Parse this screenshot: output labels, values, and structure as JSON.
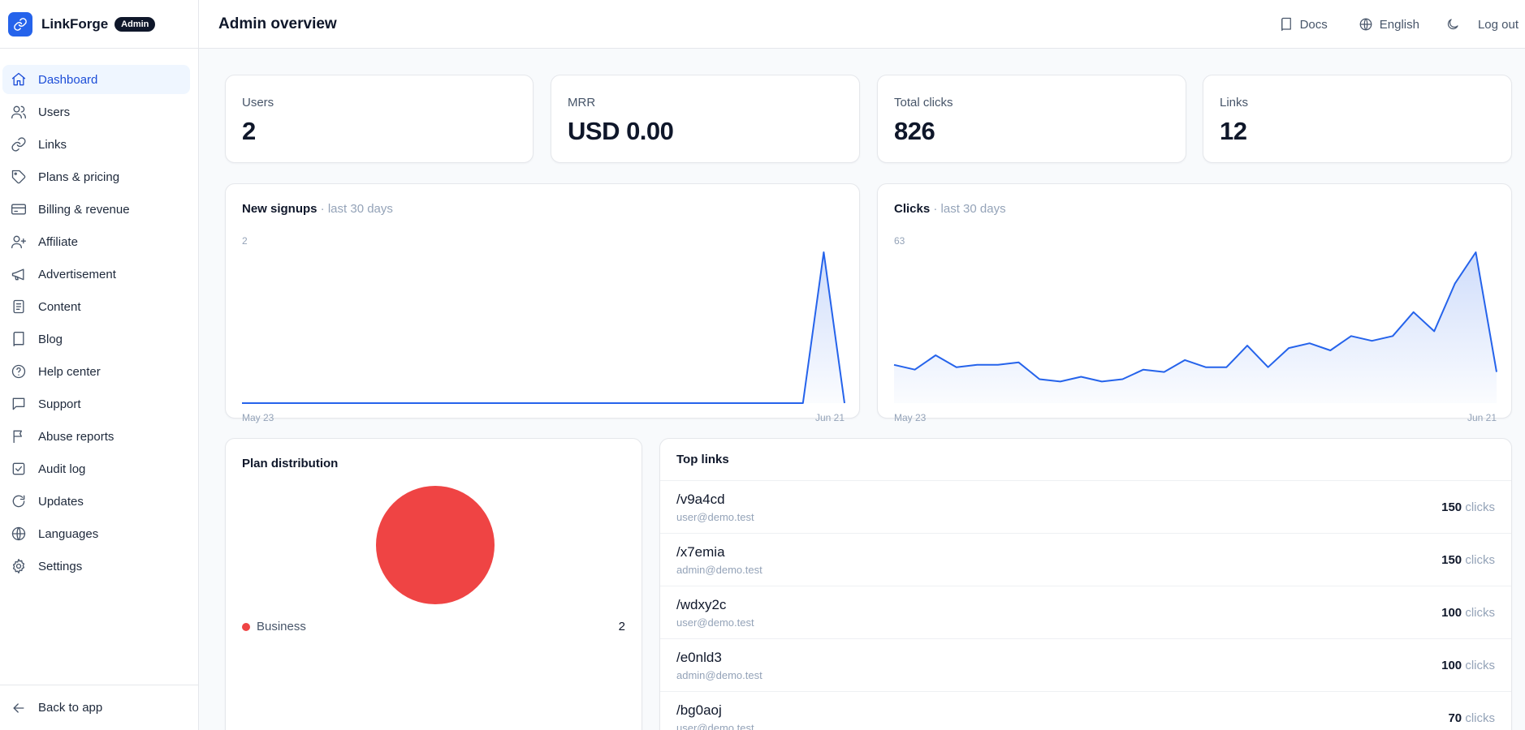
{
  "brand": {
    "name": "LinkForge",
    "badge": "Admin"
  },
  "sidebar": {
    "items": [
      {
        "label": "Dashboard",
        "icon": "home-icon",
        "active": true
      },
      {
        "label": "Users",
        "icon": "users-icon"
      },
      {
        "label": "Links",
        "icon": "link-icon"
      },
      {
        "label": "Plans & pricing",
        "icon": "tag-icon"
      },
      {
        "label": "Billing & revenue",
        "icon": "credit-card-icon"
      },
      {
        "label": "Affiliate",
        "icon": "user-plus-icon"
      },
      {
        "label": "Advertisement",
        "icon": "megaphone-icon"
      },
      {
        "label": "Content",
        "icon": "document-icon"
      },
      {
        "label": "Blog",
        "icon": "book-icon"
      },
      {
        "label": "Help center",
        "icon": "help-circle-icon"
      },
      {
        "label": "Support",
        "icon": "message-icon"
      },
      {
        "label": "Abuse reports",
        "icon": "flag-icon"
      },
      {
        "label": "Audit log",
        "icon": "check-square-icon"
      },
      {
        "label": "Updates",
        "icon": "refresh-icon"
      },
      {
        "label": "Languages",
        "icon": "globe-icon"
      },
      {
        "label": "Settings",
        "icon": "gear-icon"
      }
    ],
    "back": "Back to app"
  },
  "header": {
    "title": "Admin overview",
    "docs": "Docs",
    "language": "English",
    "logout": "Log out"
  },
  "stats": [
    {
      "label": "Users",
      "value": "2"
    },
    {
      "label": "MRR",
      "value": "USD 0.00"
    },
    {
      "label": "Total clicks",
      "value": "826"
    },
    {
      "label": "Links",
      "value": "12"
    }
  ],
  "signups_chart": {
    "title": "New signups",
    "subtitle": " · last 30 days",
    "max_label": "2",
    "x_start": "May 23",
    "x_end": "Jun 21"
  },
  "clicks_chart": {
    "title": "Clicks",
    "subtitle": " · last 30 days",
    "max_label": "63",
    "x_start": "May 23",
    "x_end": "Jun 21"
  },
  "chart_data": [
    {
      "type": "area",
      "x_range": [
        "May 23",
        "Jun 21"
      ],
      "ylim": [
        0,
        2
      ],
      "color": "#2563eb",
      "values": [
        0,
        0,
        0,
        0,
        0,
        0,
        0,
        0,
        0,
        0,
        0,
        0,
        0,
        0,
        0,
        0,
        0,
        0,
        0,
        0,
        0,
        0,
        0,
        0,
        0,
        0,
        0,
        0,
        2,
        0
      ]
    },
    {
      "type": "area",
      "x_range": [
        "May 23",
        "Jun 21"
      ],
      "ylim": [
        0,
        63
      ],
      "color": "#2563eb",
      "values": [
        16,
        14,
        20,
        15,
        16,
        16,
        17,
        10,
        9,
        11,
        9,
        10,
        14,
        13,
        18,
        15,
        15,
        24,
        15,
        23,
        25,
        22,
        28,
        26,
        28,
        38,
        30,
        50,
        63,
        13
      ]
    }
  ],
  "plan_distribution": {
    "title": "Plan distribution",
    "slices": [
      {
        "name": "Business",
        "value": 2,
        "color": "#ef4444"
      }
    ]
  },
  "top_links": {
    "title": "Top links",
    "unit": " clicks",
    "rows": [
      {
        "slug": "/v9a4cd",
        "owner": "user@demo.test",
        "clicks": "150"
      },
      {
        "slug": "/x7emia",
        "owner": "admin@demo.test",
        "clicks": "150"
      },
      {
        "slug": "/wdxy2c",
        "owner": "user@demo.test",
        "clicks": "100"
      },
      {
        "slug": "/e0nld3",
        "owner": "admin@demo.test",
        "clicks": "100"
      },
      {
        "slug": "/bg0aoj",
        "owner": "user@demo.test",
        "clicks": "70"
      }
    ]
  }
}
